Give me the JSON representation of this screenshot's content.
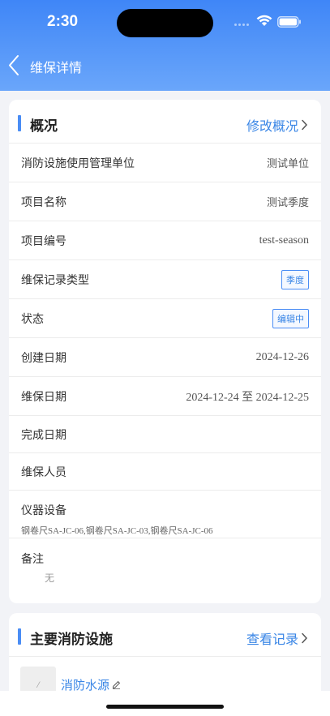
{
  "status_bar": {
    "time": "2:30"
  },
  "nav": {
    "title": "维保详情"
  },
  "overview": {
    "title": "概况",
    "edit_label": "修改概况",
    "rows": {
      "unit": {
        "label": "消防设施使用管理单位",
        "value": "测试单位"
      },
      "project_name": {
        "label": "项目名称",
        "value": "测试季度"
      },
      "project_code": {
        "label": "项目编号",
        "value": "test-season"
      },
      "record_type": {
        "label": "维保记录类型",
        "value": "季度"
      },
      "status": {
        "label": "状态",
        "value": "编辑中"
      },
      "created": {
        "label": "创建日期",
        "value": "2024-12-26"
      },
      "maint_date": {
        "label": "维保日期",
        "value": "2024-12-24 至 2024-12-25"
      },
      "finish_date": {
        "label": "完成日期",
        "value": ""
      },
      "personnel": {
        "label": "维保人员",
        "value": ""
      },
      "instruments": {
        "label": "仪器设备",
        "value": "钢卷尺SA-JC-06,钢卷尺SA-JC-03,钢卷尺SA-JC-06"
      },
      "notes": {
        "label": "备注",
        "value": "无"
      }
    }
  },
  "main_facilities": {
    "title": "主要消防设施",
    "view_label": "查看记录",
    "items": [
      {
        "thumb": "/",
        "name": "消防水源"
      }
    ]
  },
  "colors": {
    "accent": "#3a86e6",
    "header_top": "#3f86f7",
    "header_bottom": "#6aa6fa"
  }
}
